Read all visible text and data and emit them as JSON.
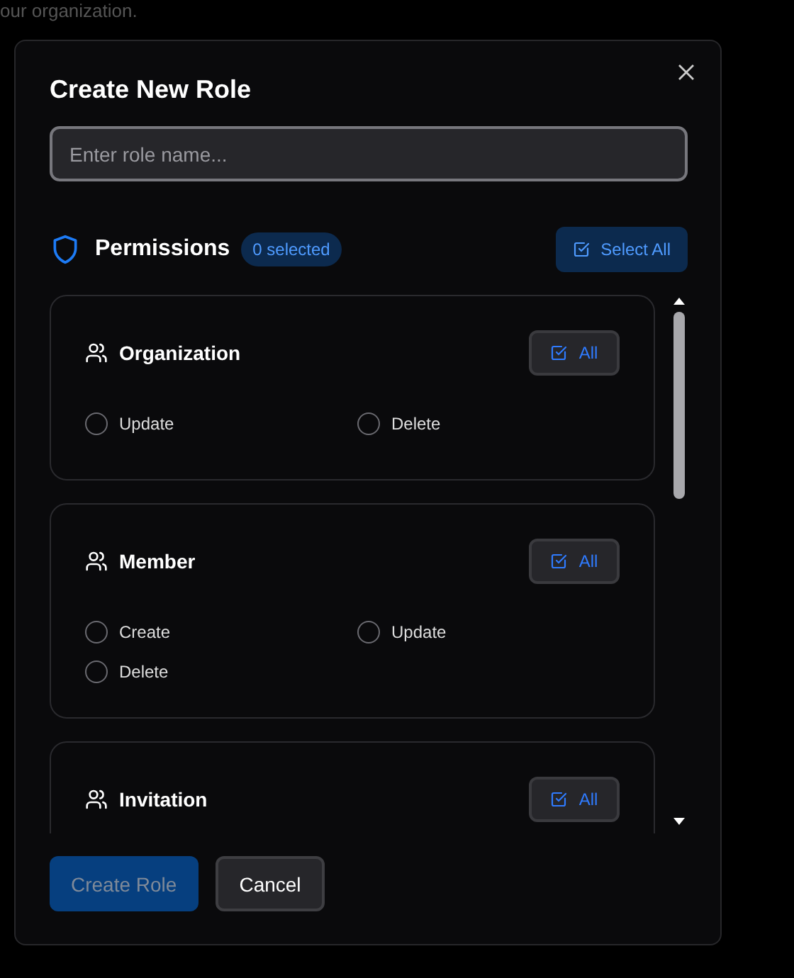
{
  "background_text": "our organization.",
  "dialog": {
    "title": "Create New Role",
    "role_name": {
      "placeholder": "Enter role name..."
    },
    "permissions": {
      "title": "Permissions",
      "count": "0 selected",
      "select_all": "Select All"
    },
    "groups": [
      {
        "name": "Organization",
        "all_label": "All",
        "actions": [
          {
            "label": "Update",
            "checked": false
          },
          {
            "label": "Delete",
            "checked": false
          }
        ]
      },
      {
        "name": "Member",
        "all_label": "All",
        "actions": [
          {
            "label": "Create",
            "checked": false
          },
          {
            "label": "Update",
            "checked": false
          },
          {
            "label": "Delete",
            "checked": false
          }
        ]
      },
      {
        "name": "Invitation",
        "all_label": "All"
      }
    ],
    "buttons": [
      {
        "label": "Create Role",
        "kind": "primary",
        "disabled": true
      },
      {
        "label": "Cancel",
        "kind": "secondary",
        "disabled": false
      }
    ]
  }
}
